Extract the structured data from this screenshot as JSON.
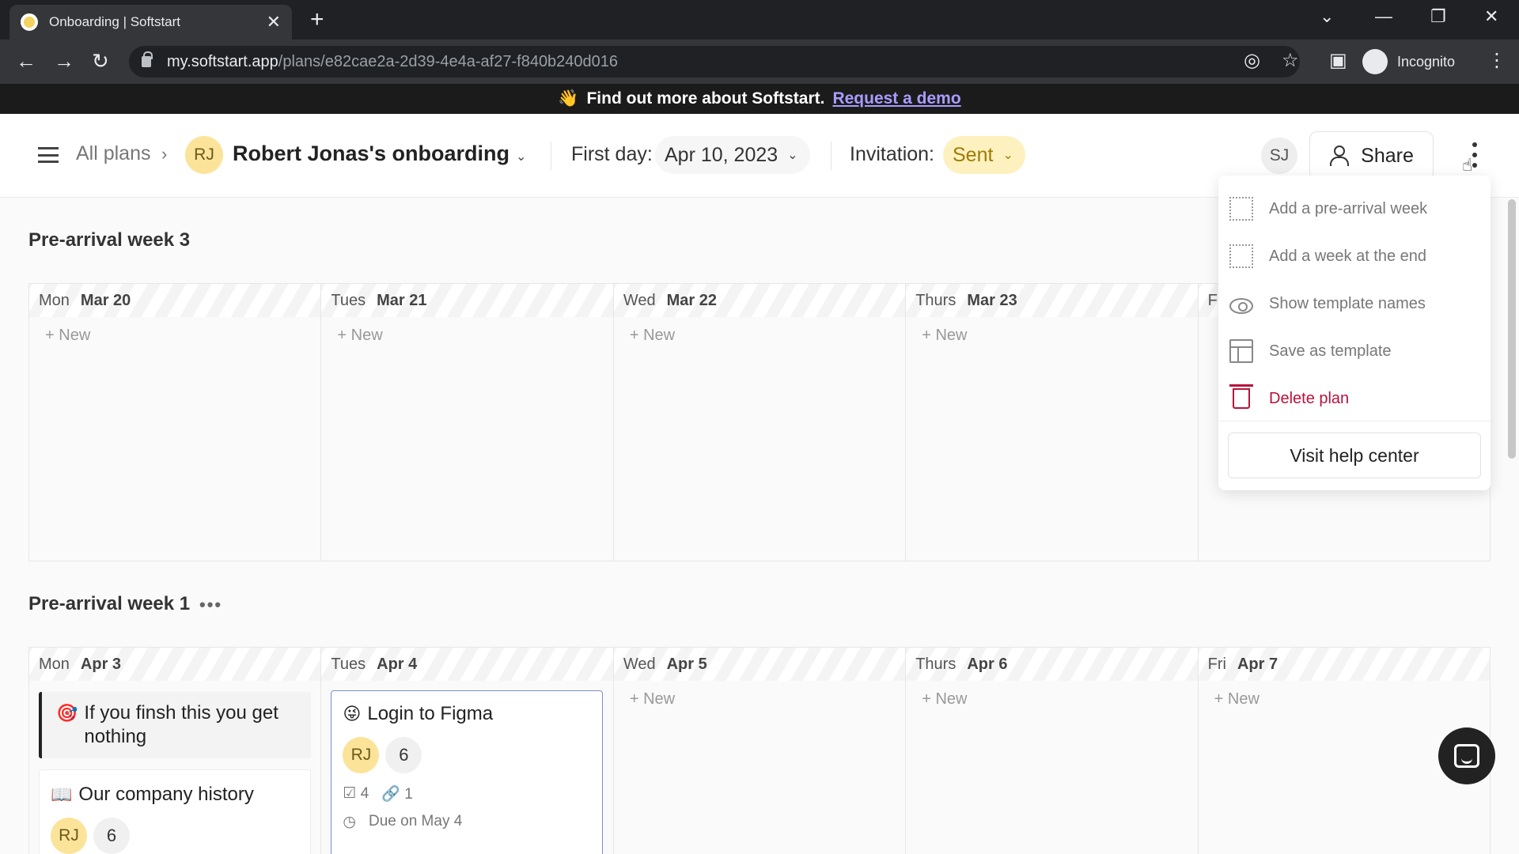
{
  "browser": {
    "tab_title": "Onboarding | Softstart",
    "url_host": "my.softstart.app",
    "url_path": "/plans/e82cae2a-2d39-4e4a-af27-f840b240d016",
    "profile_label": "Incognito"
  },
  "banner": {
    "emoji": "👋",
    "text": "Find out more about Softstart.",
    "link": "Request a demo"
  },
  "header": {
    "all_plans": "All plans",
    "avatar_initials": "RJ",
    "plan_title": "Robert Jonas's onboarding",
    "first_day_label": "First day:",
    "first_day_value": "Apr 10, 2023",
    "invitation_label": "Invitation:",
    "invitation_value": "Sent",
    "user_initials": "SJ",
    "share_label": "Share"
  },
  "weeks": [
    {
      "title": "Pre-arrival week 3",
      "days": [
        {
          "dow": "Mon",
          "date": "Mar 20",
          "new": "New"
        },
        {
          "dow": "Tues",
          "date": "Mar 21",
          "new": "New"
        },
        {
          "dow": "Wed",
          "date": "Mar 22",
          "new": "New"
        },
        {
          "dow": "Thurs",
          "date": "Mar 23",
          "new": "New"
        },
        {
          "dow": "F",
          "date": "",
          "new": ""
        }
      ]
    },
    {
      "title": "Pre-arrival week 1",
      "menu_dots": "•••",
      "days": [
        {
          "dow": "Mon",
          "date": "Apr 3",
          "new": ""
        },
        {
          "dow": "Tues",
          "date": "Apr 4",
          "new": ""
        },
        {
          "dow": "Wed",
          "date": "Apr 5",
          "new": "New"
        },
        {
          "dow": "Thurs",
          "date": "Apr 6",
          "new": "New"
        },
        {
          "dow": "Fri",
          "date": "Apr 7",
          "new": "New"
        }
      ]
    }
  ],
  "cards": {
    "finish": {
      "emoji": "🎯",
      "title": "If you finsh this you get nothing"
    },
    "history": {
      "emoji": "📖",
      "title": "Our company history",
      "assignee": "RJ",
      "count": "6"
    },
    "figma": {
      "emoji": "😜",
      "title": "Login to Figma",
      "assignee": "RJ",
      "count": "6",
      "checks": "4",
      "links": "1",
      "due": "Due on May 4"
    }
  },
  "menu": {
    "items": [
      {
        "label": "Add a pre-arrival week",
        "icon": "dotted-grid-icon"
      },
      {
        "label": "Add a week at the end",
        "icon": "dotted-grid-icon"
      },
      {
        "label": "Show template names",
        "icon": "eye-icon"
      },
      {
        "label": "Save as template",
        "icon": "template-icon"
      },
      {
        "label": "Delete plan",
        "icon": "trash-icon"
      }
    ],
    "help": "Visit help center"
  },
  "colors": {
    "accent_yellow": "#fbe49a",
    "danger": "#b8123a",
    "banner_link": "#a89cff"
  }
}
